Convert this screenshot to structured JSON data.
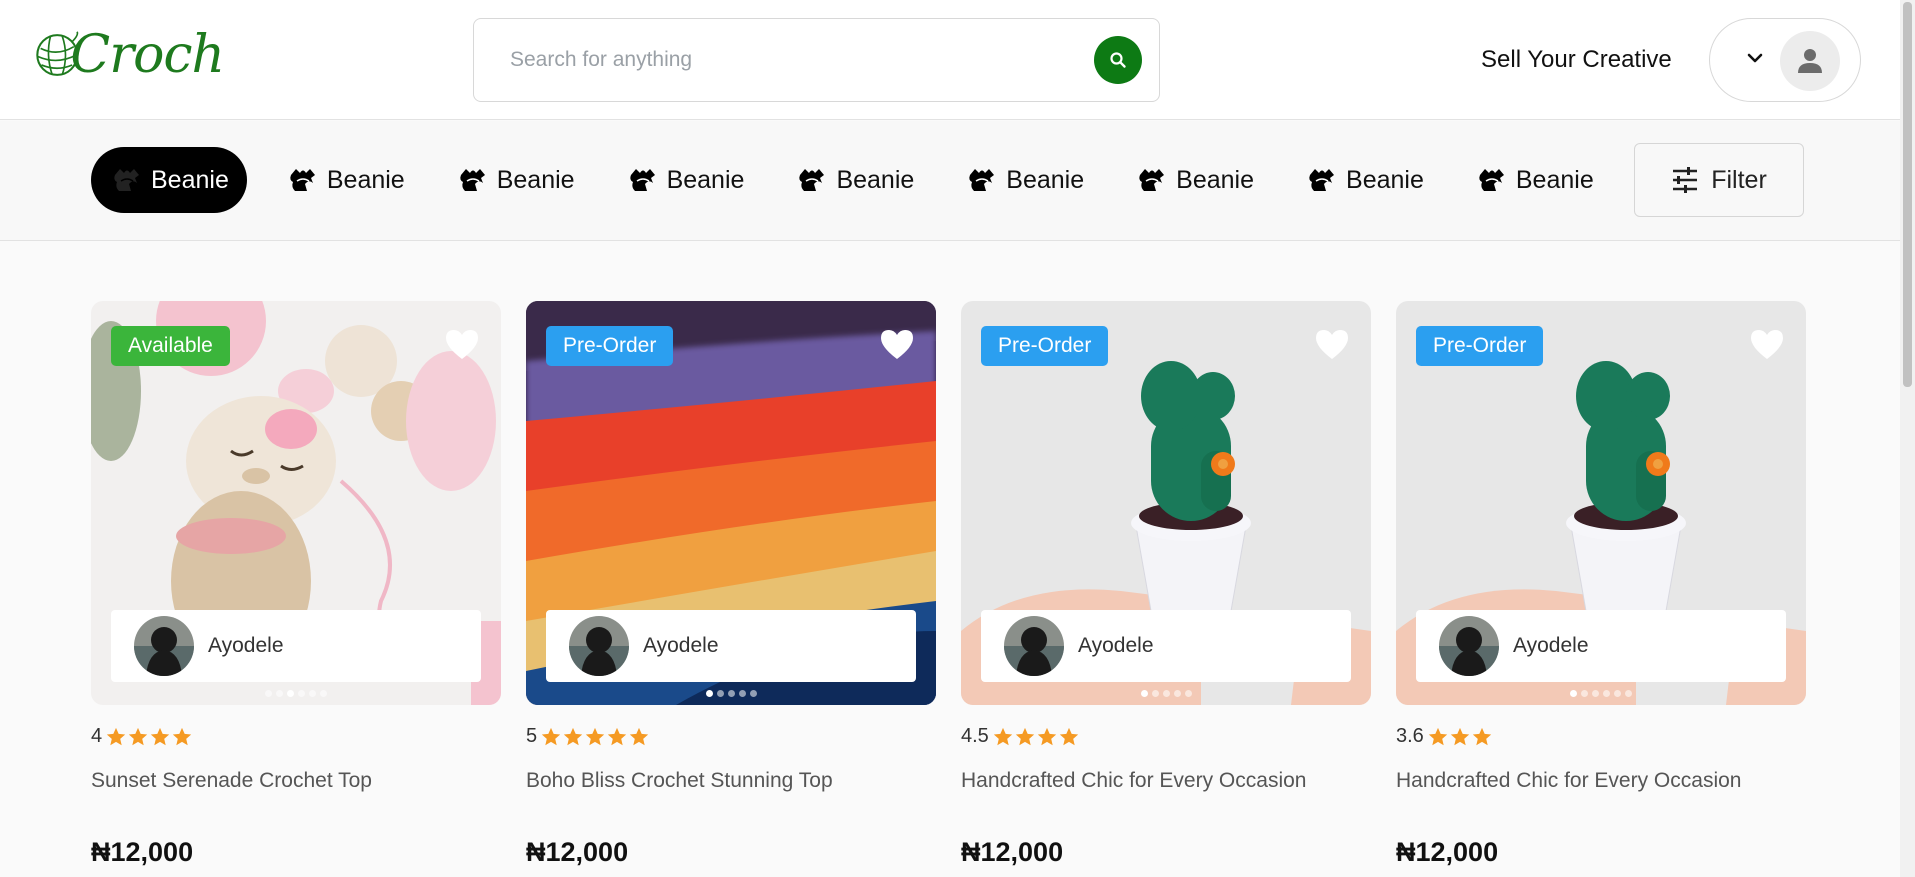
{
  "brand": {
    "logo_text": "Croch",
    "logo_color": "#1e7a1e"
  },
  "header": {
    "search_placeholder": "Search for anything",
    "search_button_icon": "search-icon",
    "sell_link": "Sell Your Creative",
    "account_icon": "user-icon",
    "account_menu_icon": "chevron-down-icon"
  },
  "categories": {
    "items": [
      {
        "label": "Beanie",
        "active": true
      },
      {
        "label": "Beanie",
        "active": false
      },
      {
        "label": "Beanie",
        "active": false
      },
      {
        "label": "Beanie",
        "active": false
      },
      {
        "label": "Beanie",
        "active": false
      },
      {
        "label": "Beanie",
        "active": false
      },
      {
        "label": "Beanie",
        "active": false
      },
      {
        "label": "Beanie",
        "active": false
      },
      {
        "label": "Beanie",
        "active": false
      }
    ],
    "filter_label": "Filter",
    "filter_icon": "sliders-icon"
  },
  "colors": {
    "accent_green": "#0d7a14",
    "available": "#3bb53b",
    "preorder": "#2b9ff0",
    "star": "#f59a23"
  },
  "products": [
    {
      "badge": "Available",
      "badge_type": "available",
      "seller": "Ayodele",
      "rating": "4",
      "stars": 4,
      "title": "Sunset Serenade Crochet Top",
      "price": "₦12,000",
      "image": "crochet-deer-toy",
      "carousel_index": 3,
      "carousel_count": 6
    },
    {
      "badge": "Pre-Order",
      "badge_type": "preorder",
      "seller": "Ayodele",
      "rating": "5",
      "stars": 5,
      "title": "Boho Bliss Crochet Stunning Top",
      "price": "₦12,000",
      "image": "rainbow-crochet-blanket",
      "carousel_index": 1,
      "carousel_count": 5
    },
    {
      "badge": "Pre-Order",
      "badge_type": "preorder",
      "seller": "Ayodele",
      "rating": "4.5",
      "stars": 4,
      "title": "Handcrafted Chic for Every Occasion",
      "price": "₦12,000",
      "image": "crochet-cactus",
      "carousel_index": 1,
      "carousel_count": 5
    },
    {
      "badge": "Pre-Order",
      "badge_type": "preorder",
      "seller": "Ayodele",
      "rating": "3.6",
      "stars": 3,
      "title": "Handcrafted Chic for Every Occasion",
      "price": "₦12,000",
      "image": "crochet-cactus",
      "carousel_index": 1,
      "carousel_count": 6
    }
  ]
}
